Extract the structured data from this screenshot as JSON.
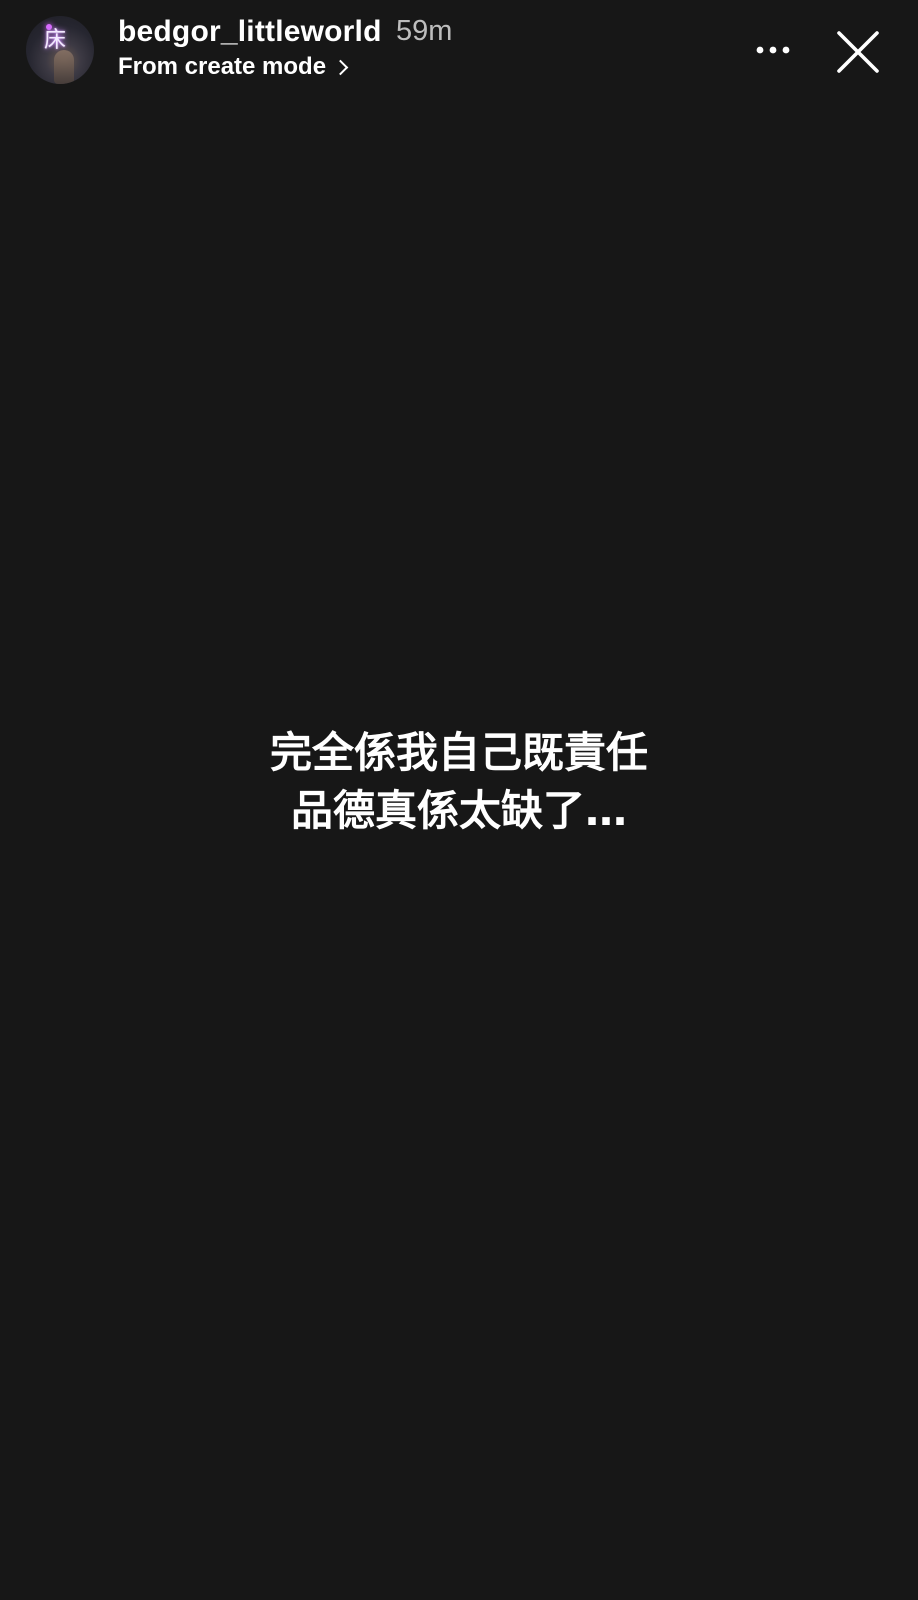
{
  "header": {
    "username": "bedgor_littleworld",
    "time_ago": "59m",
    "subtitle": "From create mode",
    "avatar": {
      "glyph": "床",
      "accent_color": "#d86bff"
    },
    "icons": {
      "more": "more-horizontal-icon",
      "close": "close-icon",
      "subtitle_arrow": "chevron-right-icon"
    }
  },
  "story": {
    "background_color": "#171717",
    "text_lines": [
      "完全係我自己既責任",
      "品德真係太缺了…"
    ]
  }
}
